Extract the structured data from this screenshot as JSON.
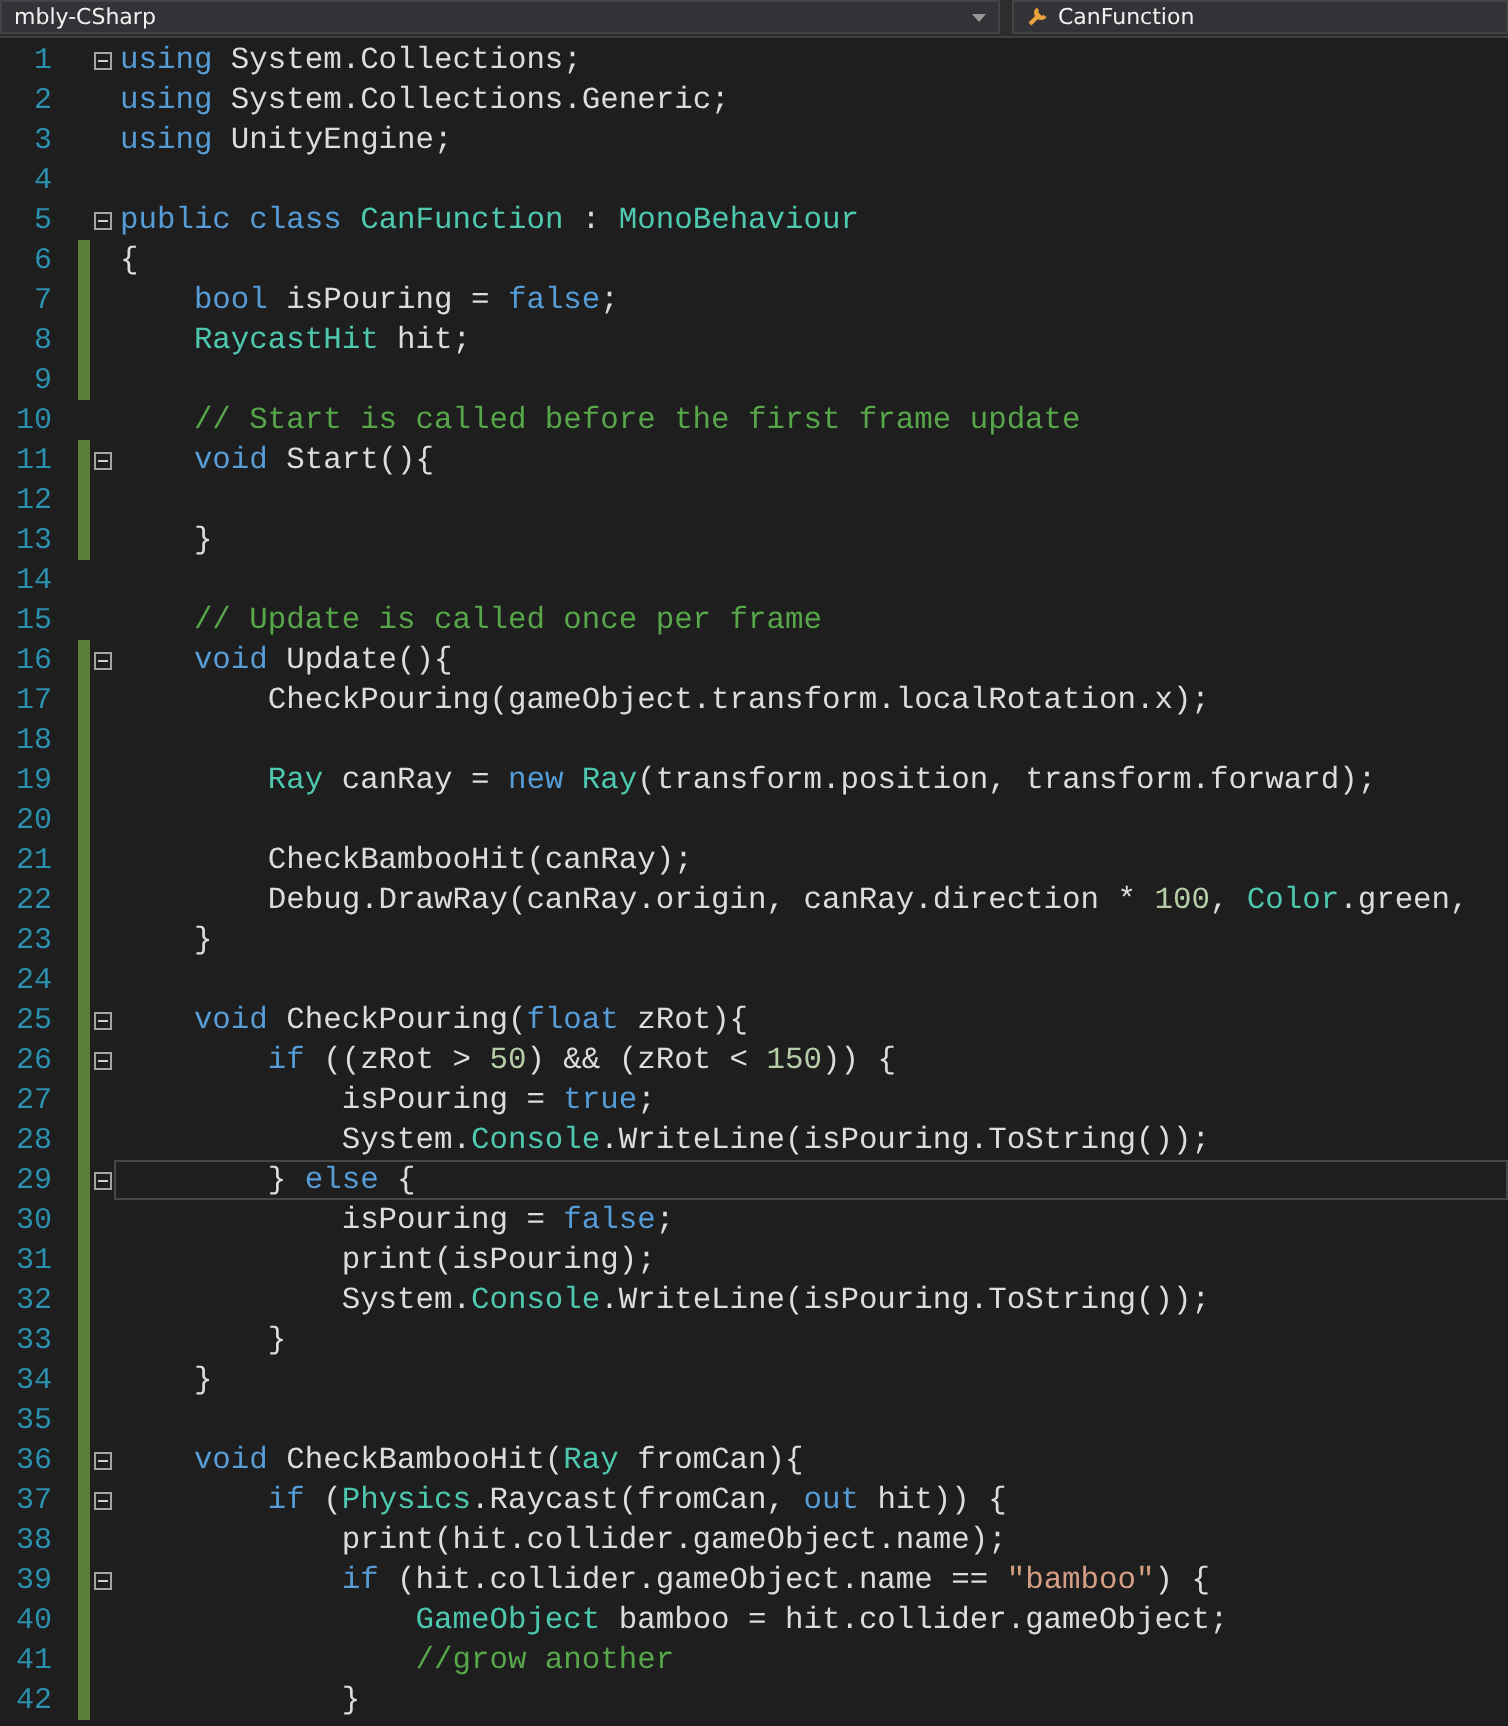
{
  "navigation_bar": {
    "project_dropdown": "mbly-CSharp",
    "member_dropdown": "CanFunction"
  },
  "lines": [
    {
      "number": "1",
      "changed": false,
      "fold": true,
      "current": false,
      "tokens": [
        {
          "kind": "keyword",
          "text": "using"
        },
        {
          "kind": "plain",
          "text": " System.Collections;"
        }
      ]
    },
    {
      "number": "2",
      "changed": false,
      "fold": false,
      "current": false,
      "tokens": [
        {
          "kind": "keyword",
          "text": "using"
        },
        {
          "kind": "plain",
          "text": " System.Collections.Generic;"
        }
      ]
    },
    {
      "number": "3",
      "changed": false,
      "fold": false,
      "current": false,
      "tokens": [
        {
          "kind": "keyword",
          "text": "using"
        },
        {
          "kind": "plain",
          "text": " UnityEngine;"
        }
      ]
    },
    {
      "number": "4",
      "changed": false,
      "fold": false,
      "current": false
    },
    {
      "number": "5",
      "changed": false,
      "fold": true,
      "current": false,
      "tokens": [
        {
          "kind": "keyword",
          "text": "public class"
        },
        {
          "kind": "type",
          "text": " CanFunction"
        },
        {
          "kind": "plain",
          "text": " : "
        },
        {
          "kind": "type",
          "text": "MonoBehaviour"
        }
      ]
    },
    {
      "number": "6",
      "changed": true,
      "fold": false,
      "current": false,
      "tokens": [
        {
          "kind": "plain",
          "text": "{"
        }
      ]
    },
    {
      "number": "7",
      "changed": true,
      "fold": false,
      "current": false,
      "tokens": [
        {
          "kind": "keyword",
          "text": "    bool"
        },
        {
          "kind": "plain",
          "text": " isPouring = "
        },
        {
          "kind": "keyword",
          "text": "false"
        },
        {
          "kind": "plain",
          "text": ";"
        }
      ]
    },
    {
      "number": "8",
      "changed": true,
      "fold": false,
      "current": false,
      "tokens": [
        {
          "kind": "type",
          "text": "    RaycastHit"
        },
        {
          "kind": "plain",
          "text": " hit;"
        }
      ]
    },
    {
      "number": "9",
      "changed": true,
      "fold": false,
      "current": false
    },
    {
      "number": "10",
      "changed": false,
      "fold": false,
      "current": false,
      "tokens": [
        {
          "kind": "comment",
          "text": "    // Start is called before the first frame update"
        }
      ]
    },
    {
      "number": "11",
      "changed": true,
      "fold": true,
      "current": false,
      "tokens": [
        {
          "kind": "keyword",
          "text": "    void"
        },
        {
          "kind": "plain",
          "text": " Start(){"
        }
      ]
    },
    {
      "number": "12",
      "changed": true,
      "fold": false,
      "current": false
    },
    {
      "number": "13",
      "changed": true,
      "fold": false,
      "current": false,
      "tokens": [
        {
          "kind": "plain",
          "text": "    }"
        }
      ]
    },
    {
      "number": "14",
      "changed": false,
      "fold": false,
      "current": false
    },
    {
      "number": "15",
      "changed": false,
      "fold": false,
      "current": false,
      "tokens": [
        {
          "kind": "comment",
          "text": "    // Update is called once per frame"
        }
      ]
    },
    {
      "number": "16",
      "changed": true,
      "fold": true,
      "current": false,
      "tokens": [
        {
          "kind": "keyword",
          "text": "    void"
        },
        {
          "kind": "plain",
          "text": " Update(){"
        }
      ]
    },
    {
      "number": "17",
      "changed": true,
      "fold": false,
      "current": false,
      "tokens": [
        {
          "kind": "plain",
          "text": "        CheckPouring(gameObject.transform.localRotation.x);"
        }
      ]
    },
    {
      "number": "18",
      "changed": true,
      "fold": false,
      "current": false
    },
    {
      "number": "19",
      "changed": true,
      "fold": false,
      "current": false,
      "tokens": [
        {
          "kind": "type",
          "text": "        Ray"
        },
        {
          "kind": "plain",
          "text": " canRay = "
        },
        {
          "kind": "keyword",
          "text": "new"
        },
        {
          "kind": "type",
          "text": " Ray"
        },
        {
          "kind": "plain",
          "text": "(transform.position, transform.forward);"
        }
      ]
    },
    {
      "number": "20",
      "changed": true,
      "fold": false,
      "current": false
    },
    {
      "number": "21",
      "changed": true,
      "fold": false,
      "current": false,
      "tokens": [
        {
          "kind": "plain",
          "text": "        CheckBambooHit(canRay);"
        }
      ]
    },
    {
      "number": "22",
      "changed": true,
      "fold": false,
      "current": false,
      "tokens": [
        {
          "kind": "plain",
          "text": "        Debug.DrawRay(canRay.origin, canRay.direction * "
        },
        {
          "kind": "number",
          "text": "100"
        },
        {
          "kind": "plain",
          "text": ", "
        },
        {
          "kind": "type",
          "text": "Color"
        },
        {
          "kind": "plain",
          "text": ".green,"
        }
      ]
    },
    {
      "number": "23",
      "changed": true,
      "fold": false,
      "current": false,
      "tokens": [
        {
          "kind": "plain",
          "text": "    }"
        }
      ]
    },
    {
      "number": "24",
      "changed": true,
      "fold": false,
      "current": false
    },
    {
      "number": "25",
      "changed": true,
      "fold": true,
      "current": false,
      "tokens": [
        {
          "kind": "keyword",
          "text": "    void"
        },
        {
          "kind": "plain",
          "text": " CheckPouring("
        },
        {
          "kind": "keyword",
          "text": "float"
        },
        {
          "kind": "plain",
          "text": " zRot){"
        }
      ]
    },
    {
      "number": "26",
      "changed": true,
      "fold": true,
      "current": false,
      "tokens": [
        {
          "kind": "keyword",
          "text": "        if"
        },
        {
          "kind": "plain",
          "text": " ((zRot > "
        },
        {
          "kind": "number",
          "text": "50"
        },
        {
          "kind": "plain",
          "text": ") && (zRot < "
        },
        {
          "kind": "number",
          "text": "150"
        },
        {
          "kind": "plain",
          "text": ")) {"
        }
      ]
    },
    {
      "number": "27",
      "changed": true,
      "fold": false,
      "current": false,
      "tokens": [
        {
          "kind": "plain",
          "text": "            isPouring = "
        },
        {
          "kind": "keyword",
          "text": "true"
        },
        {
          "kind": "plain",
          "text": ";"
        }
      ]
    },
    {
      "number": "28",
      "changed": true,
      "fold": false,
      "current": false,
      "tokens": [
        {
          "kind": "plain",
          "text": "            System."
        },
        {
          "kind": "type",
          "text": "Console"
        },
        {
          "kind": "plain",
          "text": ".WriteLine(isPouring.ToString());"
        }
      ]
    },
    {
      "number": "29",
      "changed": true,
      "fold": true,
      "current": true,
      "tokens": [
        {
          "kind": "plain",
          "text": "        } "
        },
        {
          "kind": "keyword",
          "text": "else"
        },
        {
          "kind": "plain",
          "text": " {"
        }
      ]
    },
    {
      "number": "30",
      "changed": true,
      "fold": false,
      "current": false,
      "tokens": [
        {
          "kind": "plain",
          "text": "            isPouring = "
        },
        {
          "kind": "keyword",
          "text": "false"
        },
        {
          "kind": "plain",
          "text": ";"
        }
      ]
    },
    {
      "number": "31",
      "changed": true,
      "fold": false,
      "current": false,
      "tokens": [
        {
          "kind": "plain",
          "text": "            print(isPouring);"
        }
      ]
    },
    {
      "number": "32",
      "changed": true,
      "fold": false,
      "current": false,
      "tokens": [
        {
          "kind": "plain",
          "text": "            System."
        },
        {
          "kind": "type",
          "text": "Console"
        },
        {
          "kind": "plain",
          "text": ".WriteLine(isPouring.ToString());"
        }
      ]
    },
    {
      "number": "33",
      "changed": true,
      "fold": false,
      "current": false,
      "tokens": [
        {
          "kind": "plain",
          "text": "        }"
        }
      ]
    },
    {
      "number": "34",
      "changed": true,
      "fold": false,
      "current": false,
      "tokens": [
        {
          "kind": "plain",
          "text": "    }"
        }
      ]
    },
    {
      "number": "35",
      "changed": true,
      "fold": false,
      "current": false
    },
    {
      "number": "36",
      "changed": true,
      "fold": true,
      "current": false,
      "tokens": [
        {
          "kind": "keyword",
          "text": "    void"
        },
        {
          "kind": "plain",
          "text": " CheckBambooHit("
        },
        {
          "kind": "type",
          "text": "Ray"
        },
        {
          "kind": "plain",
          "text": " fromCan){"
        }
      ]
    },
    {
      "number": "37",
      "changed": true,
      "fold": true,
      "current": false,
      "tokens": [
        {
          "kind": "keyword",
          "text": "        if"
        },
        {
          "kind": "plain",
          "text": " ("
        },
        {
          "kind": "type",
          "text": "Physics"
        },
        {
          "kind": "plain",
          "text": ".Raycast(fromCan, "
        },
        {
          "kind": "keyword",
          "text": "out"
        },
        {
          "kind": "plain",
          "text": " hit)) {"
        }
      ]
    },
    {
      "number": "38",
      "changed": true,
      "fold": false,
      "current": false,
      "tokens": [
        {
          "kind": "plain",
          "text": "            print(hit.collider.gameObject.name);"
        }
      ]
    },
    {
      "number": "39",
      "changed": true,
      "fold": true,
      "current": false,
      "tokens": [
        {
          "kind": "keyword",
          "text": "            if"
        },
        {
          "kind": "plain",
          "text": " (hit.collider.gameObject.name == "
        },
        {
          "kind": "string",
          "text": "\"bamboo\""
        },
        {
          "kind": "plain",
          "text": ") {"
        }
      ]
    },
    {
      "number": "40",
      "changed": true,
      "fold": false,
      "current": false,
      "tokens": [
        {
          "kind": "type",
          "text": "                GameObject"
        },
        {
          "kind": "plain",
          "text": " bamboo = hit.collider.gameObject;"
        }
      ]
    },
    {
      "number": "41",
      "changed": true,
      "fold": false,
      "current": false,
      "tokens": [
        {
          "kind": "comment",
          "text": "                //grow another"
        }
      ]
    },
    {
      "number": "42",
      "changed": true,
      "fold": false,
      "current": false,
      "tokens": [
        {
          "kind": "plain",
          "text": "            }"
        }
      ]
    }
  ]
}
